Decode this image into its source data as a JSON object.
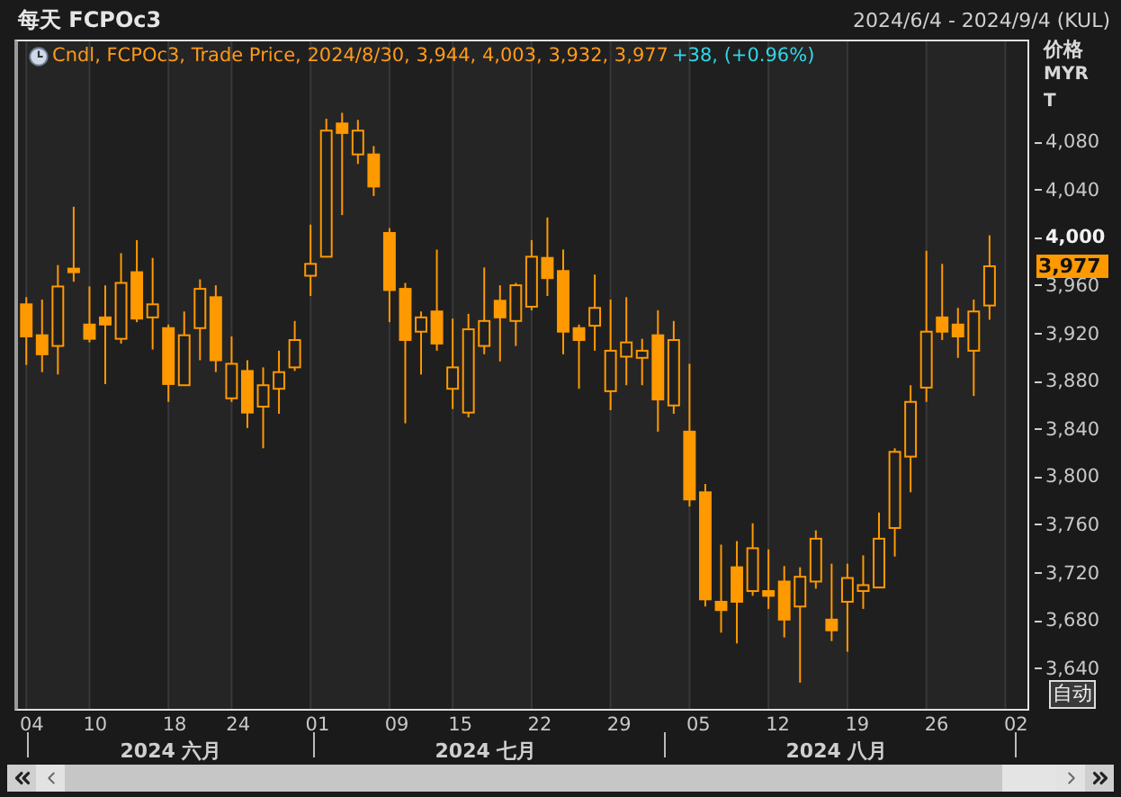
{
  "header": {
    "title": "每天 FCPOc3",
    "range": "2024/6/4 - 2024/9/4 (KUL)"
  },
  "legend": {
    "quote": "Cndl, FCPOc3, Trade Price, 2024/8/30, 3,944, 4,003, 3,932, 3,977",
    "change": "+38, (+0.96%)"
  },
  "price_axis": {
    "title": "价格",
    "currency": "MYR",
    "unit": "T",
    "auto_button": "自动",
    "tick_emphasized": [
      false,
      false,
      true,
      false,
      false,
      false,
      false,
      false,
      false,
      false,
      false,
      false
    ]
  },
  "date_axis": {
    "days": [
      "04",
      "10",
      "18",
      "24",
      "01",
      "09",
      "15",
      "22",
      "29",
      "05",
      "12",
      "19",
      "26",
      "02"
    ],
    "months": [
      "2024 六月",
      "2024 七月",
      "2024 八月"
    ]
  },
  "chart_data": {
    "type": "candlestick",
    "categories": [
      null,
      null,
      null,
      null,
      null,
      null,
      null,
      null,
      null,
      null,
      null,
      null,
      null,
      null,
      null,
      null,
      null,
      null,
      null,
      null,
      null,
      null,
      null,
      null,
      null,
      null,
      null,
      null,
      null,
      null,
      null,
      null,
      null,
      null,
      null,
      null,
      null,
      null,
      null,
      null,
      null,
      null,
      null,
      null,
      null,
      null,
      null,
      null,
      null,
      null,
      null,
      null,
      null,
      null,
      null,
      null,
      null,
      null,
      null,
      null,
      null,
      null
    ],
    "ohlc": [
      [
        3945,
        3951,
        3894,
        3918
      ],
      [
        3919,
        3949,
        3888,
        3903
      ],
      [
        3910,
        3978,
        3886,
        3960
      ],
      [
        3975,
        4027,
        3964,
        3972
      ],
      [
        3928,
        3960,
        3913,
        3916
      ],
      [
        3934,
        3961,
        3878,
        3928
      ],
      [
        3916,
        3988,
        3912,
        3963
      ],
      [
        3972,
        3999,
        3930,
        3933
      ],
      [
        3934,
        3984,
        3907,
        3945
      ],
      [
        3925,
        3928,
        3863,
        3878
      ],
      [
        3877,
        3939,
        3877,
        3919
      ],
      [
        3925,
        3966,
        3898,
        3958
      ],
      [
        3951,
        3961,
        3888,
        3898
      ],
      [
        3866,
        3918,
        3863,
        3895
      ],
      [
        3889,
        3898,
        3841,
        3854
      ],
      [
        3859,
        3892,
        3824,
        3877
      ],
      [
        3874,
        3906,
        3853,
        3888
      ],
      [
        3892,
        3931,
        3889,
        3915
      ],
      [
        3969,
        4012,
        3952,
        3979
      ],
      [
        3985,
        4101,
        3985,
        4091
      ],
      [
        4097,
        4106,
        4020,
        4089
      ],
      [
        4071,
        4100,
        4063,
        4091
      ],
      [
        4071,
        4078,
        4036,
        4044
      ],
      [
        4005,
        4009,
        3930,
        3957
      ],
      [
        3958,
        3963,
        3845,
        3915
      ],
      [
        3922,
        3939,
        3886,
        3934
      ],
      [
        3939,
        3991,
        3906,
        3912
      ],
      [
        3874,
        3933,
        3857,
        3892
      ],
      [
        3854,
        3937,
        3850,
        3924
      ],
      [
        3910,
        3976,
        3903,
        3931
      ],
      [
        3948,
        3961,
        3897,
        3934
      ],
      [
        3931,
        3963,
        3910,
        3961
      ],
      [
        3943,
        3999,
        3940,
        3985
      ],
      [
        3984,
        4018,
        3952,
        3967
      ],
      [
        3973,
        3991,
        3903,
        3922
      ],
      [
        3925,
        3928,
        3874,
        3915
      ],
      [
        3927,
        3970,
        3906,
        3942
      ],
      [
        3872,
        3949,
        3856,
        3906
      ],
      [
        3901,
        3951,
        3877,
        3913
      ],
      [
        3900,
        3916,
        3877,
        3906
      ],
      [
        3919,
        3940,
        3838,
        3865
      ],
      [
        3860,
        3931,
        3853,
        3915
      ],
      [
        3838,
        3895,
        3775,
        3781
      ],
      [
        3787,
        3794,
        3691,
        3697
      ],
      [
        3695,
        3743,
        3669,
        3688
      ],
      [
        3724,
        3746,
        3660,
        3695
      ],
      [
        3704,
        3761,
        3700,
        3740
      ],
      [
        3704,
        3739,
        3689,
        3700
      ],
      [
        3712,
        3725,
        3665,
        3680
      ],
      [
        3691,
        3724,
        3627,
        3716
      ],
      [
        3712,
        3755,
        3706,
        3748
      ],
      [
        3680,
        3727,
        3662,
        3671
      ],
      [
        3695,
        3727,
        3653,
        3715
      ],
      [
        3704,
        3734,
        3689,
        3709
      ],
      [
        3707,
        3770,
        3707,
        3748
      ],
      [
        3757,
        3824,
        3733,
        3821
      ],
      [
        3817,
        3877,
        3787,
        3863
      ],
      [
        3875,
        3990,
        3863,
        3922
      ],
      [
        3934,
        3979,
        3915,
        3922
      ],
      [
        3928,
        3942,
        3900,
        3918
      ],
      [
        3906,
        3949,
        3868,
        3939
      ],
      [
        3944,
        4003,
        3932,
        3977
      ]
    ],
    "ylim": [
      3605,
      4166
    ],
    "yticks": [
      {
        "value": 4080,
        "label": "4,080"
      },
      {
        "value": 4040,
        "label": "4,040"
      },
      {
        "value": 4000,
        "label": "4,000"
      },
      {
        "value": 3960,
        "label": "3,960"
      },
      {
        "value": 3920,
        "label": "3,920"
      },
      {
        "value": 3880,
        "label": "3,880"
      },
      {
        "value": 3840,
        "label": "3,840"
      },
      {
        "value": 3800,
        "label": "3,800"
      },
      {
        "value": 3760,
        "label": "3,760"
      },
      {
        "value": 3720,
        "label": "3,720"
      },
      {
        "value": 3680,
        "label": "3,680"
      },
      {
        "value": 3640,
        "label": "3,640"
      }
    ],
    "grid": true,
    "annotations": [
      "3,977"
    ]
  }
}
